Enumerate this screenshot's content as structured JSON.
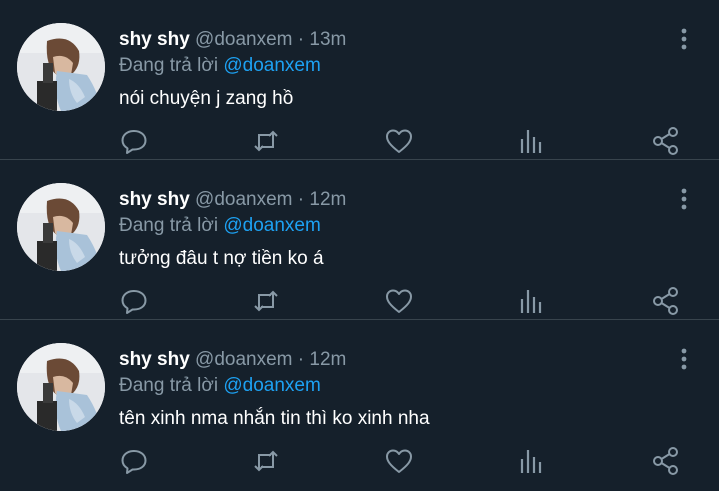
{
  "colors": {
    "background": "#15202b",
    "text": "#ffffff",
    "muted": "#8899a6",
    "accent": "#1da1f2",
    "divider": "#38444d"
  },
  "tweets": [
    {
      "name": "shy shy",
      "handle": "@doanxem",
      "dot": "·",
      "time": "13m",
      "reply_prefix": "Đang trả lời",
      "reply_to": "@doanxem",
      "text": "nói chuyện j zang hồ"
    },
    {
      "name": "shy shy",
      "handle": "@doanxem",
      "dot": "·",
      "time": "12m",
      "reply_prefix": "Đang trả lời",
      "reply_to": "@doanxem",
      "text": "tưởng đâu t nợ tiền ko á"
    },
    {
      "name": "shy shy",
      "handle": "@doanxem",
      "dot": "·",
      "time": "12m",
      "reply_prefix": "Đang trả lời",
      "reply_to": "@doanxem",
      "text": "tên xinh nma nhắn tin thì ko xinh nha"
    }
  ],
  "icons": [
    "avatar",
    "more-vertical-icon",
    "reply-icon",
    "retweet-icon",
    "like-icon",
    "stats-icon",
    "share-icon"
  ]
}
